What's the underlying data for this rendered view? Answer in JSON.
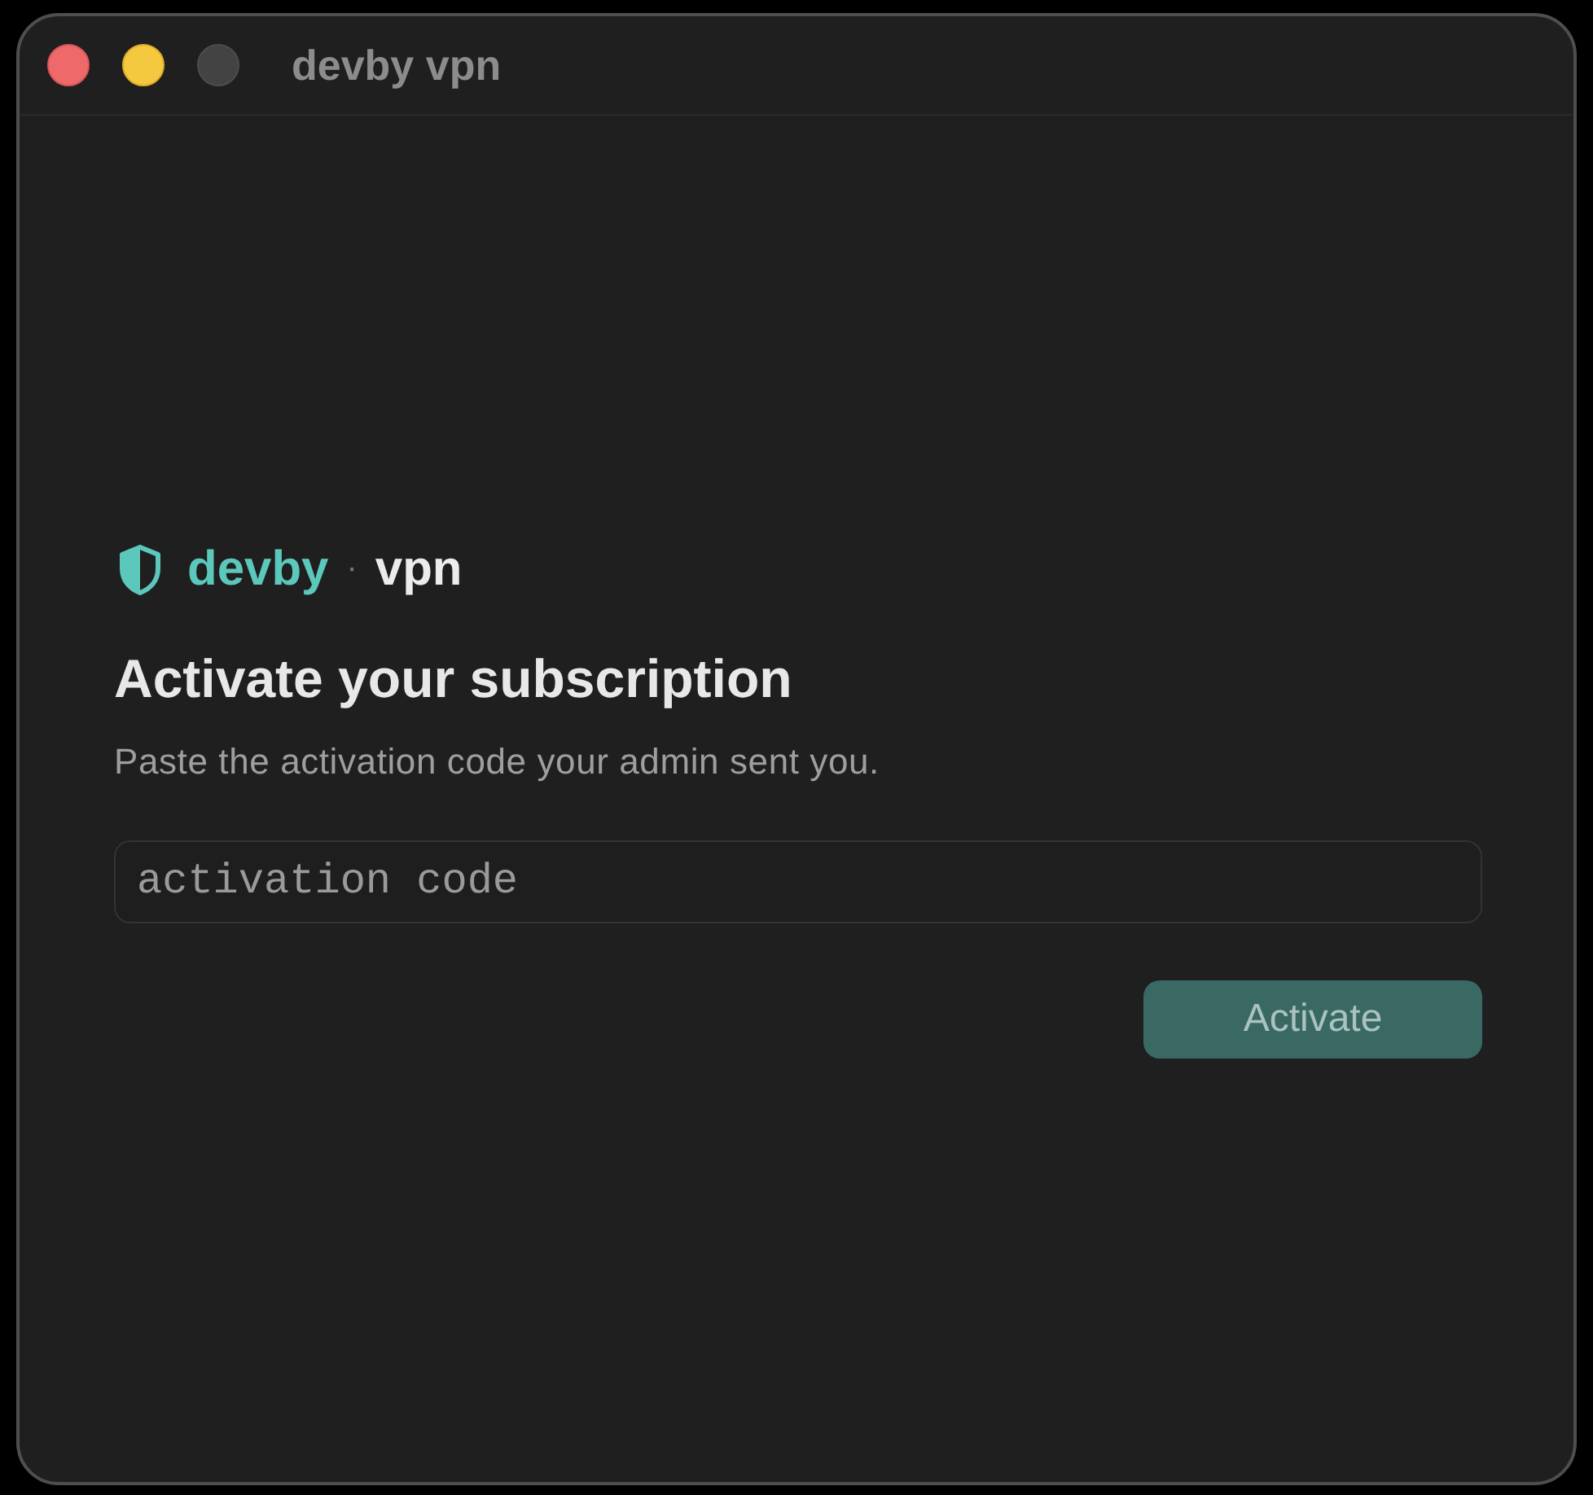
{
  "window": {
    "title": "devby vpn",
    "controls": [
      {
        "kind": "close",
        "disabled": false
      },
      {
        "kind": "minimize",
        "disabled": false
      },
      {
        "kind": "zoom",
        "disabled": true
      }
    ]
  },
  "brand": {
    "name": "devby",
    "separator": "·",
    "product": "vpn"
  },
  "heading": "Activate your subscription",
  "subtitle": "Paste the activation code your admin sent you.",
  "code_field": {
    "placeholder": "activation code"
  },
  "activate_button": {
    "label": "Activate",
    "disabled": true
  }
}
